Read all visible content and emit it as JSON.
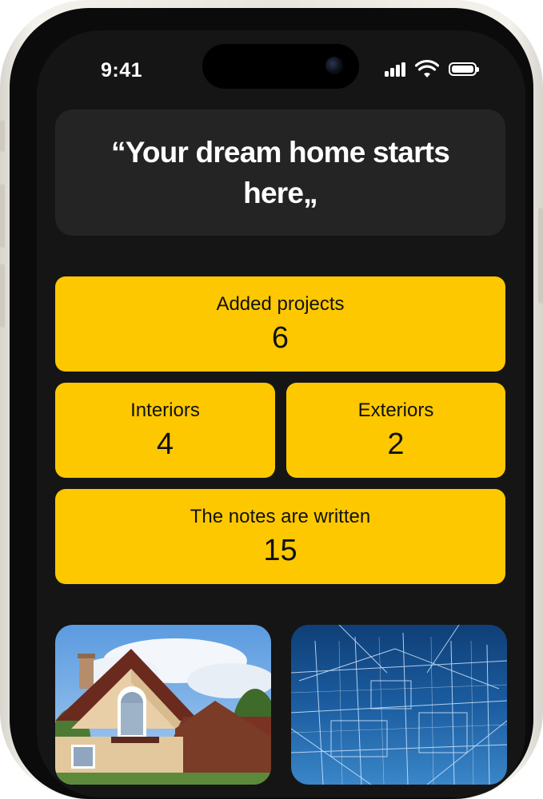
{
  "status_bar": {
    "time": "9:41"
  },
  "quote": {
    "text": "“Your dream home starts here„"
  },
  "stats": {
    "added_projects": {
      "label": "Added projects",
      "value": "6"
    },
    "interiors": {
      "label": "Interiors",
      "value": "4"
    },
    "exteriors": {
      "label": "Exteriors",
      "value": "2"
    },
    "notes": {
      "label": "The notes are written",
      "value": "15"
    }
  },
  "colors": {
    "screen_background": "#151515",
    "quote_card": "#242424",
    "accent_yellow": "#fec801"
  },
  "images": [
    {
      "name": "house-exterior-photo"
    },
    {
      "name": "interior-blueprint-photo"
    }
  ],
  "icons": [
    "cellular-signal-icon",
    "wifi-icon",
    "battery-icon"
  ]
}
